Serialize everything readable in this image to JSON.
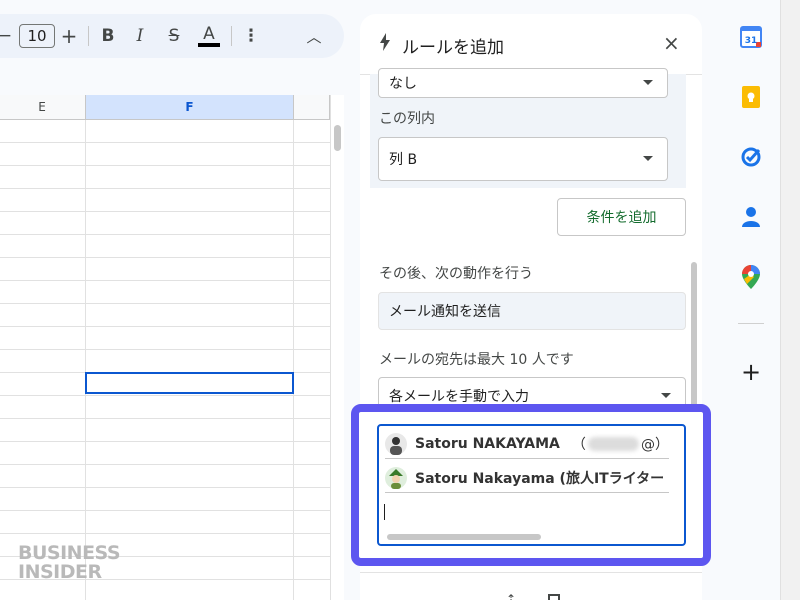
{
  "toolbar": {
    "minus": "−",
    "font_size": "10",
    "plus": "+",
    "bold": "B",
    "italic": "I",
    "strike": "S",
    "text_color": "A",
    "more": "⋮",
    "collapse": "︿"
  },
  "sheet": {
    "columns": [
      "E",
      "F"
    ],
    "selected_column": "F"
  },
  "panel": {
    "title": "ルールを追加",
    "close": "×",
    "condition_select_value": "なし",
    "column_label": "この列内",
    "column_select_value": "列 B",
    "add_condition_button": "条件を追加",
    "then_label": "その後、次の動作を行う",
    "action_value": "メール通知を送信",
    "recipients_label": "メールの宛先は最大 10 人です",
    "recipient_mode": "各メールを手動で入力",
    "recipients": [
      {
        "name": "Satoru NAKAYAMA",
        "prefix": "（",
        "suffix": "@）"
      },
      {
        "name": "Satoru Nakayama (旅人ITライター・",
        "prefix": "",
        "suffix": ""
      }
    ]
  },
  "rail": {
    "calendar_day": "31",
    "add": "+"
  },
  "watermark": {
    "line1": "BUSINESS",
    "line2": "INSIDER"
  },
  "colors": {
    "highlight": "#5d56f0",
    "accent_blue": "#0b57d0",
    "add_condition_text": "#146c2e"
  }
}
